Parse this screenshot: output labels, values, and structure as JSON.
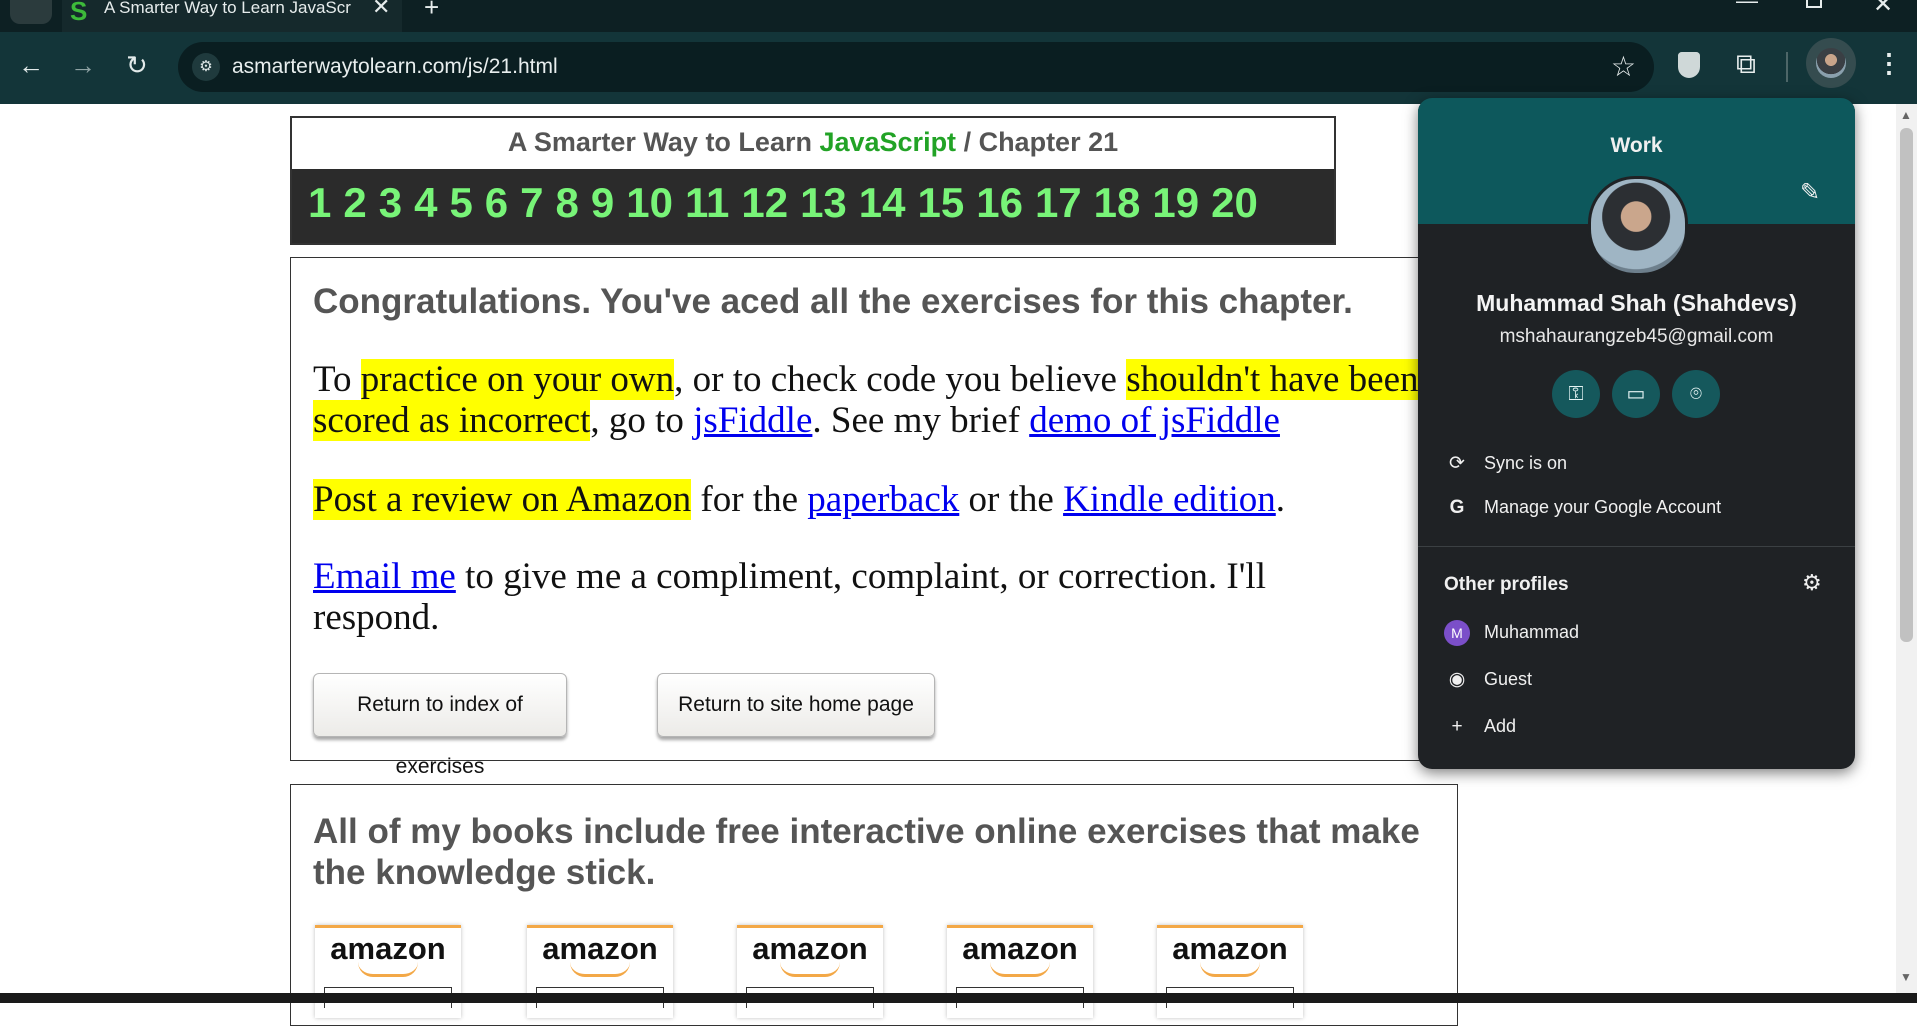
{
  "browser": {
    "tab_title": "A Smarter Way to Learn JavaScr",
    "tab_favicon": "S",
    "url": "asmarterwaytolearn.com/js/21.html",
    "icons": [
      "tab-list-icon",
      "close-icon",
      "plus-icon",
      "minimize-icon",
      "maximize-icon",
      "window-close-icon",
      "back-arrow-icon",
      "forward-arrow-icon",
      "reload-icon",
      "site-info-icon",
      "star-icon",
      "shield-extension-icon",
      "puzzle-icon",
      "kebab-menu-icon"
    ]
  },
  "page": {
    "breadcrumb": {
      "prefix": "A Smarter Way to Learn ",
      "highlight": "JavaScript",
      "suffix": " / Chapter 21"
    },
    "chapters": [
      "1",
      "2",
      "3",
      "4",
      "5",
      "6",
      "7",
      "8",
      "9",
      "10",
      "11",
      "12",
      "13",
      "14",
      "15",
      "16",
      "17",
      "18",
      "19",
      "20"
    ],
    "congrats": "Congratulations. You've aced all the exercises for this chapter.",
    "p1": {
      "t1": "To ",
      "h1": "practice on your own",
      "t2": ", or to check code you believe ",
      "h2": "shouldn't have been scored as incorrect",
      "t3": ", go to ",
      "l1": "jsFiddle",
      "t4": ". See my brief ",
      "l2": "demo of jsFiddle"
    },
    "p2": {
      "h1": "Post a review on Amazon",
      "t1": " for the ",
      "l1": "paperback",
      "t2": " or the ",
      "l2": "Kindle edition",
      "t3": "."
    },
    "p3": {
      "l1": "Email me",
      "t1": " to give me a compliment, complaint, or correction. I'll respond."
    },
    "btn_index": "Return to index of exercises",
    "btn_home": "Return to site home page",
    "books_text": "All of my books include free interactive online exercises that make the knowledge stick.",
    "amazon_logos": [
      "amazon",
      "amazon",
      "amazon",
      "amazon",
      "amazon"
    ]
  },
  "profile": {
    "label": "Work",
    "name": "Muhammad Shah (Shahdevs)",
    "email": "mshahaurangzeb45@gmail.com",
    "sync": "Sync is on",
    "manage": "Manage your Google Account",
    "other_title": "Other profiles",
    "other_initial": "M",
    "other_name": "Muhammad",
    "guest": "Guest",
    "add": "Add"
  },
  "colors": {
    "accent_green": "#22a326",
    "chapter_green": "#78f478",
    "highlight": "#ffff00",
    "popup_teal": "#0d585c"
  }
}
